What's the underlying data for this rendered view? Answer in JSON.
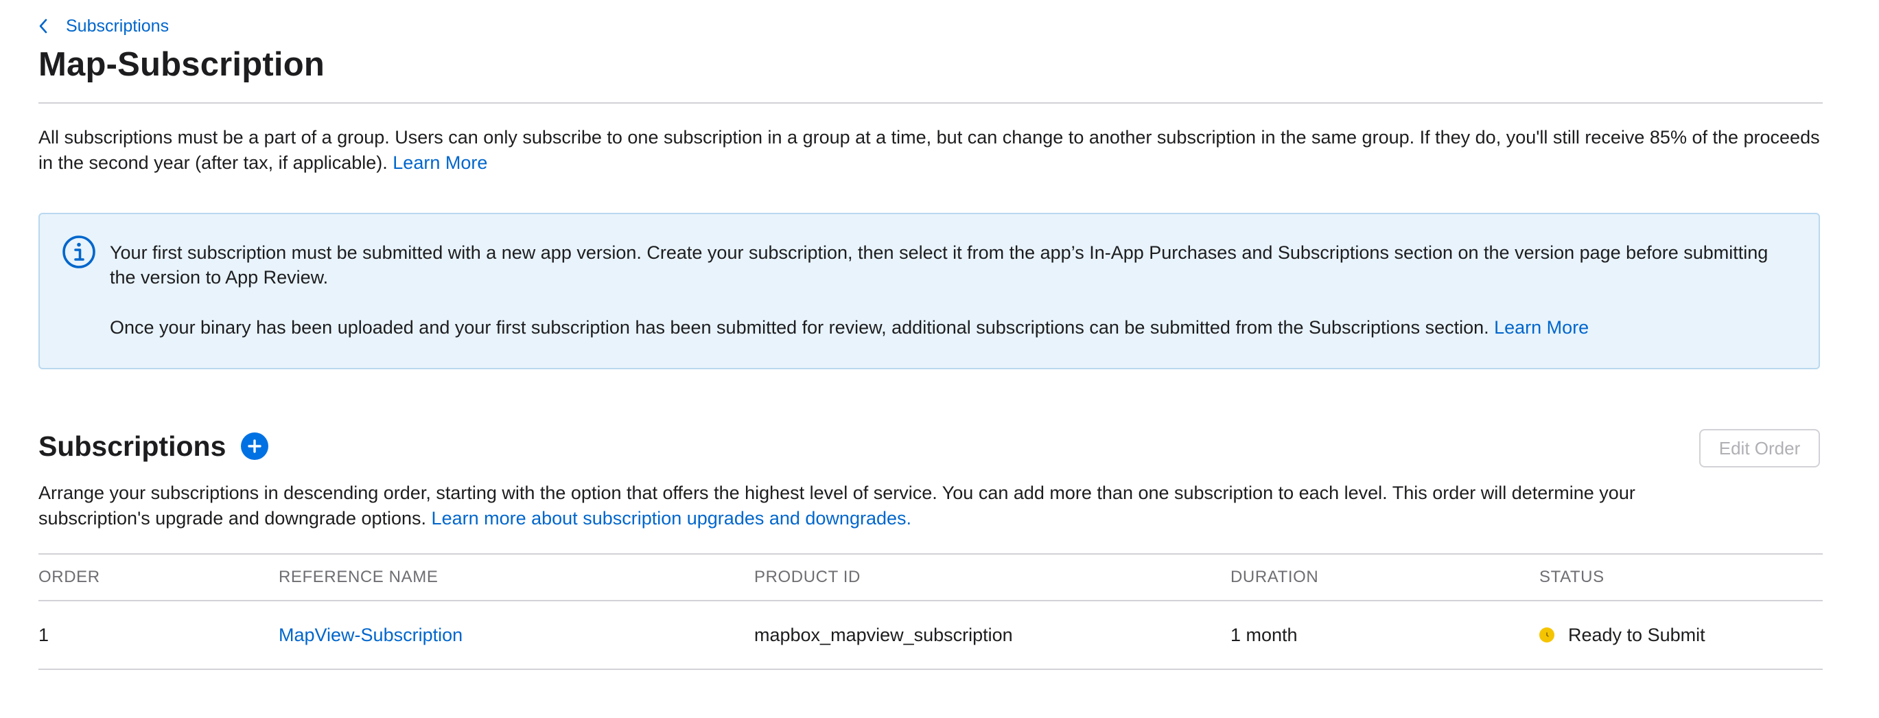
{
  "breadcrumb": {
    "label": "Subscriptions"
  },
  "page": {
    "title": "Map-Subscription"
  },
  "intro": {
    "text": "All subscriptions must be a part of a group. Users can only subscribe to one subscription in a group at a time, but can change to another subscription in the same group. If they do, you'll still receive 85% of the proceeds in the second year (after tax, if applicable). ",
    "link": "Learn More"
  },
  "info_box": {
    "icon": "info-icon",
    "paragraph1": "Your first subscription must be submitted with a new app version. Create your subscription, then select it from the app’s In-App Purchases and Subscriptions section on the version page before submitting the version to App Review.",
    "paragraph2": "Once your binary has been uploaded and your first subscription has been submitted for review, additional subscriptions can be submitted from the Subscriptions section. ",
    "paragraph2_link": "Learn More"
  },
  "subscriptions": {
    "title": "Subscriptions",
    "edit_order_label": "Edit Order",
    "description": "Arrange your subscriptions in descending order, starting with the option that offers the highest level of service. You can add more than one subscription to each level. This order will determine your subscription's upgrade and downgrade options. ",
    "description_link": "Learn more about subscription upgrades and downgrades."
  },
  "table": {
    "columns": {
      "order": "ORDER",
      "reference_name": "REFERENCE NAME",
      "product_id": "PRODUCT ID",
      "duration": "DURATION",
      "status": "STATUS"
    },
    "rows": [
      {
        "order": "1",
        "reference_name": "MapView-Subscription",
        "product_id": "mapbox_mapview_subscription",
        "duration": "1 month",
        "status": "Ready to Submit",
        "status_color": "#f5c400"
      }
    ]
  },
  "colors": {
    "link": "#0066cc",
    "accent": "#0071e3",
    "info_bg": "#e8f3fb",
    "info_border": "#b9d8ef",
    "status_ready": "#f5c400"
  }
}
